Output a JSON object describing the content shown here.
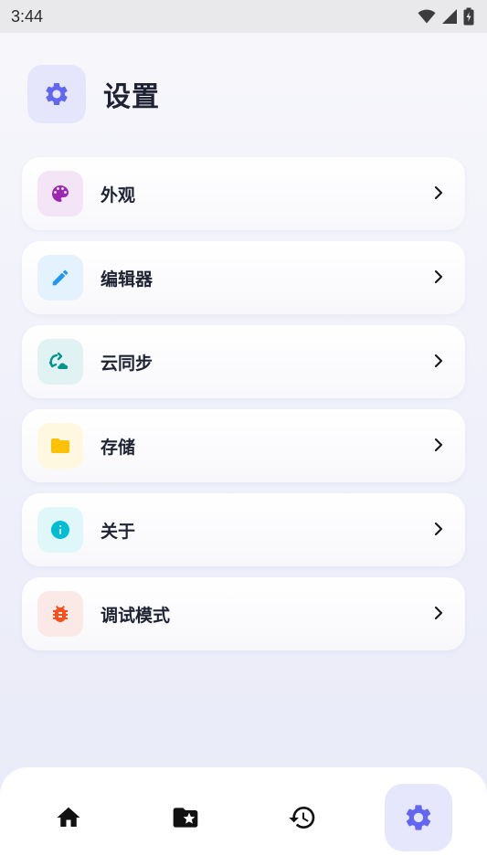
{
  "status_bar": {
    "time": "3:44",
    "icons": [
      "wifi-icon",
      "signal-icon",
      "battery-charging-icon"
    ]
  },
  "header": {
    "title": "设置",
    "icon": "gear-icon",
    "accent_color": "#6366f1"
  },
  "menu": {
    "items": [
      {
        "label": "外观",
        "icon": "palette-icon",
        "icon_color": "#9c27b0",
        "icon_bg": "#f3e5f5"
      },
      {
        "label": "编辑器",
        "icon": "pencil-icon",
        "icon_color": "#2196f3",
        "icon_bg": "#e3f2fd"
      },
      {
        "label": "云同步",
        "icon": "cloud-sync-icon",
        "icon_color": "#009688",
        "icon_bg": "#e0f2f1"
      },
      {
        "label": "存储",
        "icon": "folder-icon",
        "icon_color": "#ffc107",
        "icon_bg": "#fff8e1"
      },
      {
        "label": "关于",
        "icon": "info-icon",
        "icon_color": "#00bcd4",
        "icon_bg": "#e0f7fa"
      },
      {
        "label": "调试模式",
        "icon": "bug-icon",
        "icon_color": "#f4511e",
        "icon_bg": "#fbe9e7"
      }
    ]
  },
  "bottom_nav": {
    "items": [
      {
        "icon": "home-icon",
        "active": false
      },
      {
        "icon": "folder-star-icon",
        "active": false
      },
      {
        "icon": "history-icon",
        "active": false
      },
      {
        "icon": "gear-icon",
        "active": true
      }
    ],
    "active_color": "#6366f1"
  }
}
